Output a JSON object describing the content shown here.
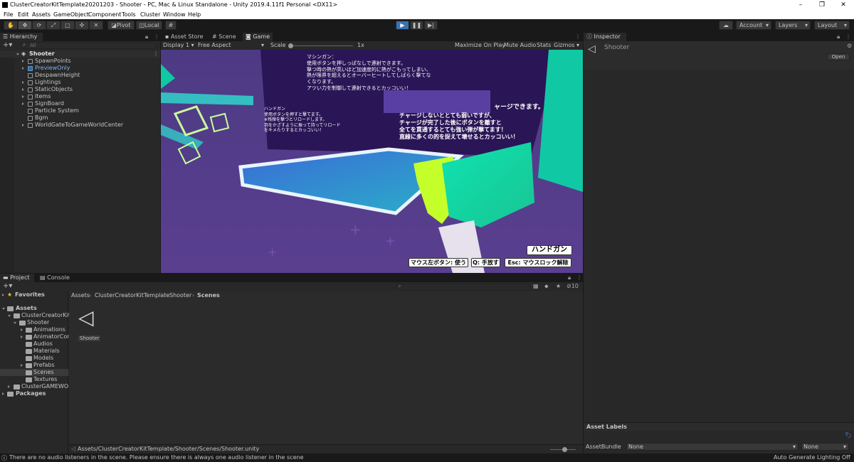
{
  "window": {
    "title": "ClusterCreatorKitTemplate20201203 - Shooter - PC, Mac & Linux Standalone - Unity 2019.4.11f1 Personal <DX11>",
    "minimize": "–",
    "maximize": "❐",
    "close": "✕"
  },
  "menu": [
    "File",
    "Edit",
    "Assets",
    "GameObject",
    "Component",
    "Tools",
    "Cluster",
    "Window",
    "Help"
  ],
  "toolbar": {
    "pivot": "Pivot",
    "local": "Local",
    "account": "Account",
    "layers": "Layers",
    "layout": "Layout"
  },
  "hierarchy": {
    "tab": "Hierarchy",
    "search_placeholder": "All",
    "root": "Shooter",
    "items": [
      "SpawnPoints",
      "PreviewOnly",
      "DespawnHeight",
      "Lightings",
      "StaticObjects",
      "Items",
      "SignBoard",
      "Particle System",
      "Bgm",
      "WorldGateToGameWorldCenter"
    ]
  },
  "center_tabs": [
    "Asset Store",
    "Scene",
    "Game"
  ],
  "game_toolbar": {
    "display": "Display 1",
    "aspect": "Free Aspect",
    "scale_label": "Scale",
    "scale_value": "1x",
    "maximize": "Maximize On Play",
    "mute": "Mute Audio",
    "stats": "Stats",
    "gizmos": "Gizmos"
  },
  "game_view": {
    "sign_machinegun": "マシンガン：\n使用ボタンを押しっぱなしで連射できます。\n撃つ時の熱が高いほど加速度的に熱がこもってしまい、\n熱が限界を超えるとオーバーヒートしてしばらく撃てな\nくなります。\nアツい力を制御して連射できるとカッコいい！",
    "sign_handgun": "ハンドガン\n使用ボタンを押すと撃てます。\n※残弾を撃つとリロードします。\n羽をかざすように振って持ってリロード\nをキメたりするとカッコいい！",
    "sign_charge_title": "ャージできます。",
    "sign_charge": "チャージしないととても弱いですが、\nチャージが完了した後にボタンを離すと\n全てを貫通するとても強い弾が撃てます！\n直線に多くの的を捉えて壊せるとカッコいい！",
    "weapon_label": "ハンドガン",
    "hints": [
      "マウス左ボタン: 使う",
      "Q: 手放す",
      "Esc: マウスロック解除"
    ]
  },
  "inspector": {
    "tab": "Inspector",
    "object": "Shooter",
    "open": "Open",
    "asset_labels": "Asset Labels",
    "asset_bundle": "AssetBundle",
    "bundle_value": "None",
    "variant_value": "None"
  },
  "project": {
    "tabs": [
      "Project",
      "Console"
    ],
    "favorites": "Favorites",
    "assets": "Assets",
    "tree": [
      "ClusterCreatorKitT",
      "Shooter",
      "Animations",
      "AnimatorCont",
      "Audios",
      "Materials",
      "Models",
      "Prefabs",
      "Scenes",
      "Textures",
      "ClusterGAMEWORI",
      "Packages"
    ],
    "breadcrumb": [
      "Assets",
      "ClusterCreatorKitTemplate",
      "Shooter",
      "Scenes"
    ],
    "file": "Shooter",
    "path": "Assets/ClusterCreatorKitTemplate/Shooter/Scenes/Shooter.unity",
    "hidden_count": "10"
  },
  "status": {
    "message": "There are no audio listeners in the scene. Please ensure there is always one audio listener in the scene",
    "lighting": "Auto Generate Lighting Off"
  }
}
